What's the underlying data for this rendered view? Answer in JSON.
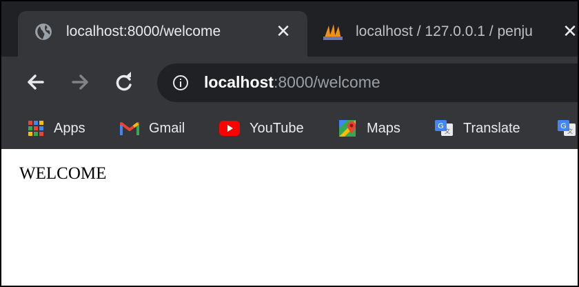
{
  "tabs": [
    {
      "title": "localhost:8000/welcome",
      "active": true,
      "favicon": "globe-icon"
    },
    {
      "title": "localhost / 127.0.0.1 / penju",
      "active": false,
      "favicon": "phpmyadmin-icon"
    }
  ],
  "tab_close_glyph": "✕",
  "toolbar": {
    "back": "arrow-left-icon",
    "forward": "arrow-right-icon",
    "reload": "reload-icon"
  },
  "address_bar": {
    "host": "localhost",
    "rest": ":8000/welcome",
    "info_icon": "info-icon"
  },
  "bookmarks": [
    {
      "label": "Apps",
      "icon": "apps-grid-icon"
    },
    {
      "label": "Gmail",
      "icon": "gmail-icon"
    },
    {
      "label": "YouTube",
      "icon": "youtube-icon"
    },
    {
      "label": "Maps",
      "icon": "maps-icon"
    },
    {
      "label": "Translate",
      "icon": "translate-icon"
    },
    {
      "label": "",
      "icon": "translate-icon"
    }
  ],
  "page": {
    "heading": "WELCOME"
  },
  "colors": {
    "titlebar": "#202124",
    "toolbar": "#35363a",
    "omnibox": "#202124",
    "text_light": "#e8eaed"
  }
}
